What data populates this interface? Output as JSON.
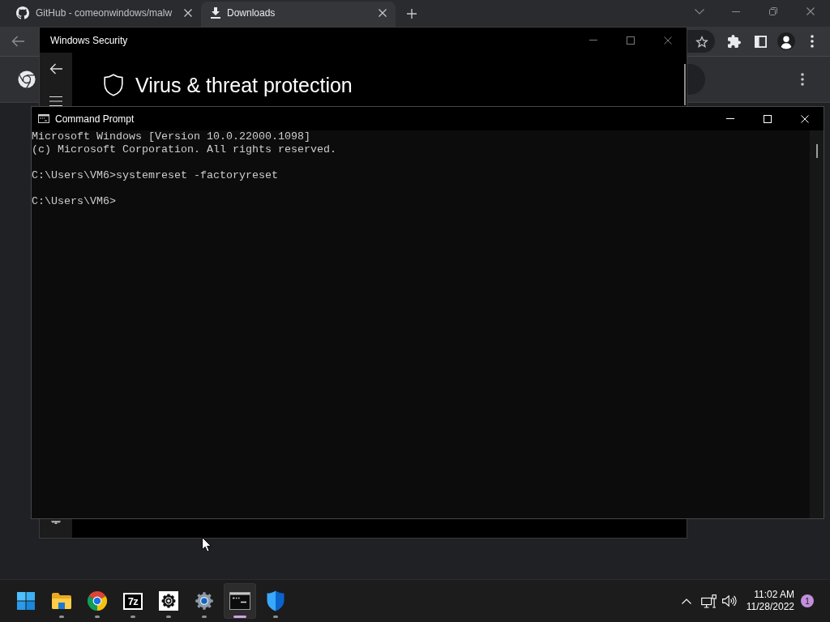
{
  "browser": {
    "tabs": [
      {
        "title": "GitHub - comeonwindows/malw",
        "kind": "github",
        "selected": false
      },
      {
        "title": "Downloads",
        "kind": "downloads",
        "selected": true
      }
    ]
  },
  "security_window": {
    "title": "Windows Security",
    "heading": "Virus & threat protection"
  },
  "console_window": {
    "title": "Command Prompt",
    "blocks": [
      {
        "lines": [
          "Microsoft Windows [Version 10.0.22000.1098]",
          "(c) Microsoft Corporation. All rights reserved."
        ]
      },
      {
        "lines": [
          "C:\\Users\\VM6>systemreset -factoryreset"
        ]
      },
      {
        "lines": [
          "C:\\Users\\VM6>"
        ]
      }
    ]
  },
  "taskbar": {
    "apps": [
      {
        "kind": "files",
        "running": true,
        "selected": false
      },
      {
        "kind": "browser",
        "running": true,
        "selected": false
      },
      {
        "kind": "archiver",
        "label": "7z",
        "running": true,
        "selected": false
      },
      {
        "kind": "control",
        "running": true,
        "selected": false
      },
      {
        "kind": "settings",
        "running": true,
        "selected": false
      },
      {
        "kind": "terminal",
        "running": true,
        "selected": true
      },
      {
        "kind": "security",
        "running": true,
        "selected": false
      }
    ],
    "tray": {
      "time": "11:02 AM",
      "date": "11/28/2022",
      "notifications": "1"
    }
  }
}
